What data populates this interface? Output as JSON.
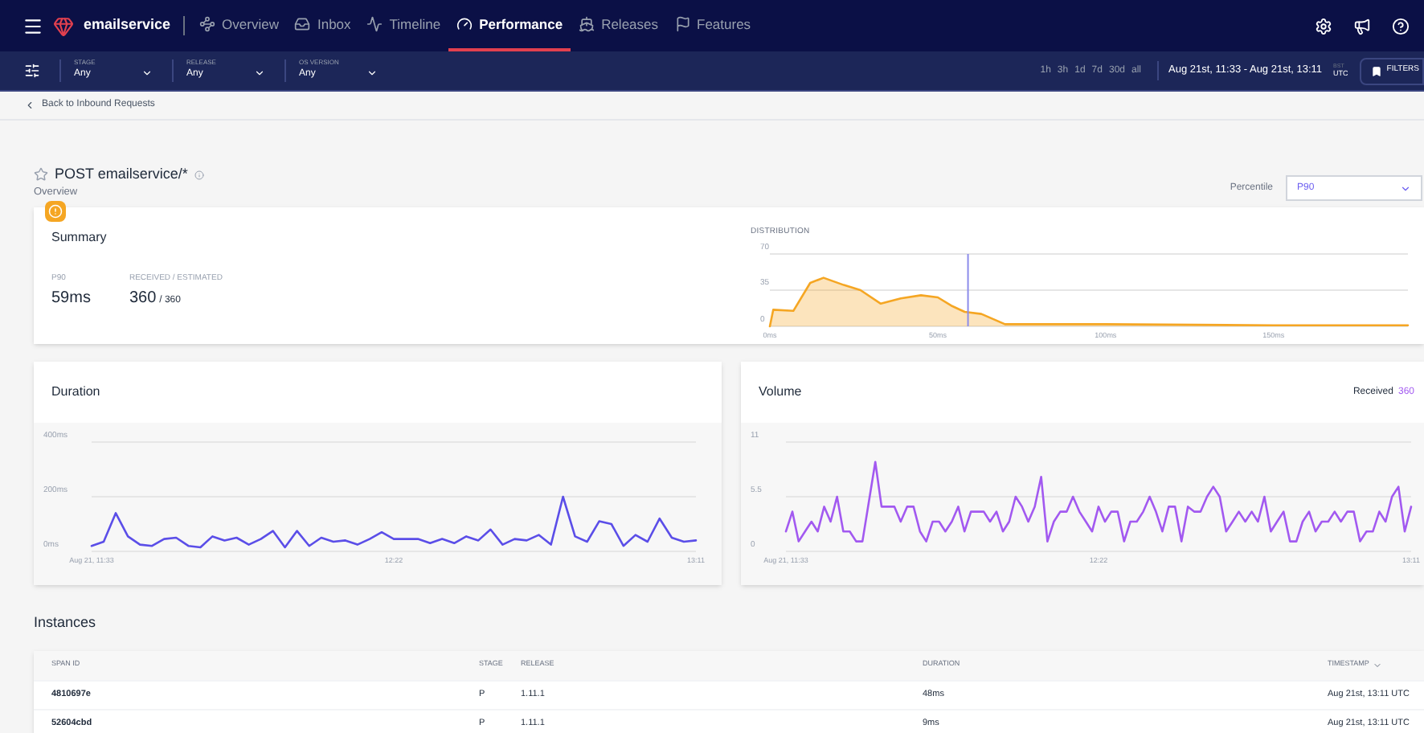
{
  "topbar": {
    "app_name": "emailservice",
    "tabs": [
      {
        "label": "Overview",
        "selected": false
      },
      {
        "label": "Inbox",
        "selected": false
      },
      {
        "label": "Timeline",
        "selected": false
      },
      {
        "label": "Performance",
        "selected": true
      },
      {
        "label": "Releases",
        "selected": false
      },
      {
        "label": "Features",
        "selected": false
      }
    ]
  },
  "filter_bar": {
    "filters": [
      {
        "label": "STAGE",
        "value": "Any"
      },
      {
        "label": "RELEASE",
        "value": "Any"
      },
      {
        "label": "OS VERSION",
        "value": "Any"
      }
    ],
    "ranges": [
      "1h",
      "3h",
      "1d",
      "7d",
      "30d",
      "all"
    ],
    "date_range": "Aug 21st, 11:33 - Aug 21st, 13:11",
    "timezone": {
      "top": "BST",
      "bottom": "UTC"
    },
    "filters_button": "FILTERS"
  },
  "back_link": "Back to Inbound Requests",
  "page": {
    "title": "POST emailservice/*",
    "subtitle": "Overview",
    "percentile": {
      "label": "Percentile",
      "value": "P90"
    }
  },
  "summary": {
    "title": "Summary",
    "p_label": "P90",
    "p_value": "59ms",
    "received_label": "RECEIVED / ESTIMATED",
    "received": "360",
    "estimated": "/ 360",
    "distribution": {
      "title": "DISTRIBUTION",
      "chart_data": {
        "type": "area",
        "x": [
          0,
          1,
          7,
          12,
          16,
          22,
          27,
          33,
          39,
          45,
          50,
          54,
          58,
          63,
          70,
          100,
          150,
          190
        ],
        "series": [
          {
            "color": "#f5a623",
            "values": [
              0,
              16,
              15,
              42,
              47,
              40,
              35,
              22,
              27,
              30,
              28,
              20,
              14,
              12,
              2,
              2,
              1,
              1
            ]
          }
        ],
        "xlim": [
          0,
          190
        ],
        "ylim": [
          0,
          70
        ],
        "yticks": [
          0,
          35,
          70
        ],
        "xticks": [
          {
            "value": 0,
            "label": "0ms"
          },
          {
            "value": 50,
            "label": "50ms"
          },
          {
            "value": 100,
            "label": "100ms"
          },
          {
            "value": 150,
            "label": "150ms"
          }
        ],
        "ref_lines": [
          {
            "axis": "x",
            "value": 59
          }
        ]
      }
    }
  },
  "duration": {
    "title": "Duration",
    "chart_data": {
      "type": "line",
      "categories": [
        "Aug 21, 11:33",
        null,
        null,
        null,
        null,
        null,
        null,
        null,
        null,
        null,
        null,
        null,
        null,
        null,
        null,
        null,
        null,
        null,
        null,
        null,
        null,
        null,
        null,
        null,
        null,
        "12:22",
        null,
        null,
        null,
        null,
        null,
        null,
        null,
        null,
        null,
        null,
        null,
        null,
        null,
        null,
        null,
        null,
        null,
        null,
        null,
        null,
        null,
        null,
        null,
        null,
        "13:11"
      ],
      "series": [
        {
          "color": "#5b4ee8",
          "values": [
            20,
            35,
            140,
            55,
            25,
            20,
            45,
            50,
            20,
            15,
            55,
            40,
            50,
            25,
            45,
            75,
            15,
            75,
            20,
            50,
            35,
            40,
            25,
            45,
            70,
            45,
            45,
            45,
            30,
            45,
            30,
            55,
            40,
            80,
            25,
            45,
            40,
            60,
            25,
            200,
            55,
            35,
            110,
            100,
            20,
            60,
            35,
            120,
            50,
            35,
            40
          ]
        }
      ],
      "ylim": [
        0,
        400
      ],
      "yticks": [
        {
          "value": 0,
          "label": "0ms"
        },
        {
          "value": 200,
          "label": "200ms"
        },
        {
          "value": 400,
          "label": "400ms"
        }
      ]
    }
  },
  "volume": {
    "title": "Volume",
    "received_label": "Received",
    "received_value": "360",
    "chart_data": {
      "type": "line",
      "categories": [
        "Aug 21, 11:33",
        null,
        null,
        null,
        null,
        null,
        null,
        null,
        null,
        null,
        null,
        null,
        null,
        null,
        null,
        null,
        null,
        null,
        null,
        null,
        null,
        null,
        null,
        null,
        null,
        null,
        null,
        null,
        null,
        null,
        null,
        null,
        null,
        null,
        null,
        null,
        null,
        null,
        null,
        null,
        null,
        null,
        null,
        null,
        null,
        null,
        null,
        null,
        null,
        "12:22",
        null,
        null,
        null,
        null,
        null,
        null,
        null,
        null,
        null,
        null,
        null,
        null,
        null,
        null,
        null,
        null,
        null,
        null,
        null,
        null,
        null,
        null,
        null,
        null,
        null,
        null,
        null,
        null,
        null,
        null,
        null,
        null,
        null,
        null,
        null,
        null,
        null,
        null,
        null,
        null,
        null,
        null,
        null,
        null,
        null,
        null,
        null,
        null,
        "13:11"
      ],
      "series": [
        {
          "color": "#a259f0",
          "values": [
            2,
            4,
            1,
            2,
            3,
            2,
            4.5,
            3,
            5.5,
            2,
            2,
            1,
            1,
            5,
            9,
            4.5,
            4.5,
            4.5,
            3,
            4.5,
            4.5,
            2,
            1,
            3,
            3,
            2,
            3,
            4.5,
            2,
            4,
            4,
            4,
            3,
            4,
            2,
            3,
            5.5,
            4.5,
            3,
            4.5,
            7.5,
            1,
            3,
            4,
            4,
            5.5,
            4,
            3,
            2,
            4.5,
            3,
            4,
            4,
            1,
            3,
            3,
            4,
            5.5,
            4,
            2,
            4.5,
            4.5,
            1,
            4.5,
            4,
            4,
            5.5,
            6.5,
            5.5,
            2,
            3,
            4,
            3,
            4,
            3,
            5.5,
            2,
            3,
            4,
            1,
            1,
            3,
            4,
            2,
            3,
            3,
            4,
            3,
            4,
            4,
            1,
            2,
            2,
            4,
            3,
            5.5,
            6.5,
            2,
            4.5
          ]
        }
      ],
      "ylim": [
        0,
        11
      ],
      "yticks": [
        0,
        5.5,
        11
      ]
    }
  },
  "instances": {
    "title": "Instances",
    "columns": [
      "SPAN ID",
      "STAGE",
      "RELEASE",
      "DURATION",
      "TIMESTAMP"
    ],
    "rows": [
      {
        "span_id": "4810697e",
        "stage": "P",
        "release": "1.11.1",
        "duration": "48ms",
        "timestamp": "Aug 21st, 13:11 UTC"
      },
      {
        "span_id": "52604cbd",
        "stage": "P",
        "release": "1.11.1",
        "duration": "9ms",
        "timestamp": "Aug 21st, 13:11 UTC"
      }
    ]
  }
}
